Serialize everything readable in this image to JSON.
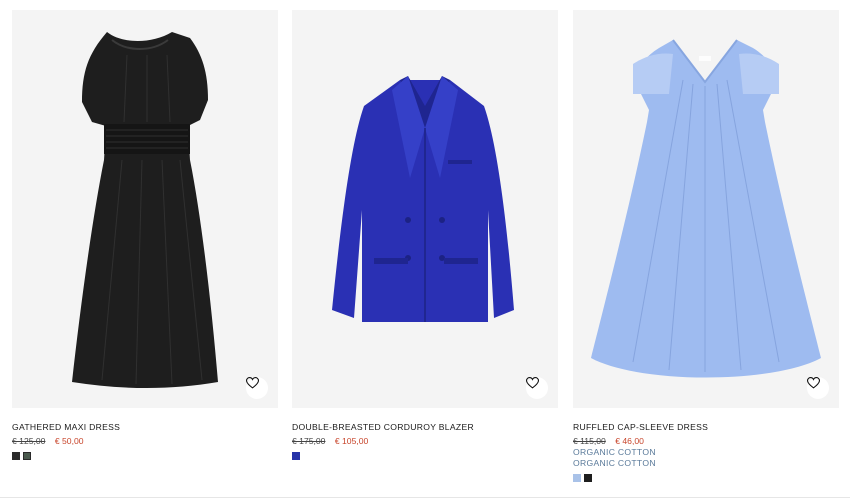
{
  "products": [
    {
      "name": "GATHERED MAXI DRESS",
      "old_price": "€ 125,00",
      "sale_price": "€ 50,00",
      "tags": [],
      "swatches": [
        "#2a2a2a",
        "#4a5a4e"
      ],
      "icon": "heart-icon"
    },
    {
      "name": "DOUBLE-BREASTED CORDUROY BLAZER",
      "old_price": "€ 175,00",
      "sale_price": "€ 105,00",
      "tags": [],
      "swatches": [
        "#2633a8"
      ],
      "icon": "heart-icon"
    },
    {
      "name": "RUFFLED CAP-SLEEVE DRESS",
      "old_price": "€ 115,00",
      "sale_price": "€ 46,00",
      "tags": [
        "ORGANIC COTTON",
        "ORGANIC COTTON"
      ],
      "swatches": [
        "#a9c2e8",
        "#1e1e1e"
      ],
      "icon": "heart-icon"
    }
  ],
  "colors": {
    "sale": "#c8452b",
    "tag": "#5a7a9a",
    "image_bg": "#f4f4f4"
  }
}
